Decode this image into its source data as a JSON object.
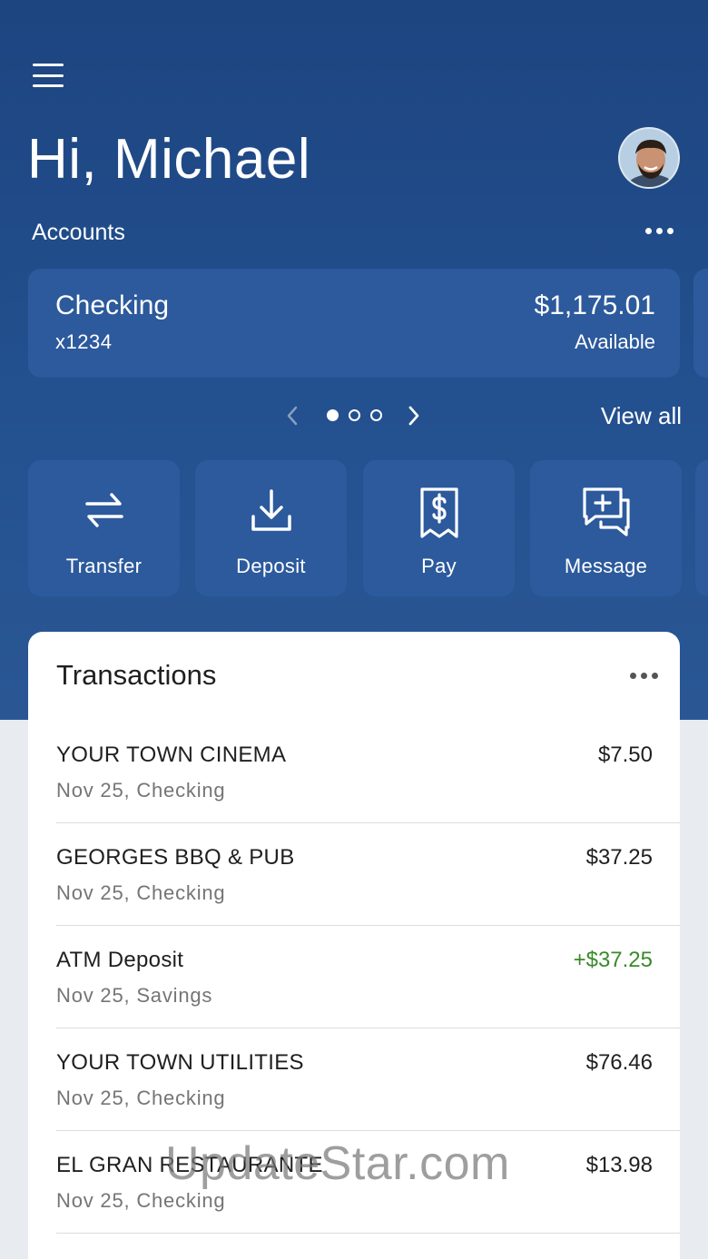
{
  "header": {
    "greeting": "Hi, Michael"
  },
  "accounts": {
    "label": "Accounts",
    "card": {
      "name": "Checking",
      "number": "x1234",
      "balance": "$1,175.01",
      "balance_label": "Available"
    },
    "pager": {
      "count": 3,
      "active_index": 0
    },
    "view_all": "View all"
  },
  "actions": [
    {
      "label": "Transfer",
      "icon": "transfer-icon"
    },
    {
      "label": "Deposit",
      "icon": "deposit-icon"
    },
    {
      "label": "Pay",
      "icon": "pay-bill-icon"
    },
    {
      "label": "Message",
      "icon": "message-icon"
    }
  ],
  "transactions": {
    "title": "Transactions",
    "items": [
      {
        "merchant": "YOUR TOWN CINEMA",
        "meta": "Nov 25, Checking",
        "amount": "$7.50",
        "credit": false
      },
      {
        "merchant": "GEORGES BBQ & PUB",
        "meta": "Nov 25, Checking",
        "amount": "$37.25",
        "credit": false
      },
      {
        "merchant": "ATM Deposit",
        "meta": "Nov 25, Savings",
        "amount": "+$37.25",
        "credit": true
      },
      {
        "merchant": "YOUR TOWN UTILITIES",
        "meta": "Nov 25, Checking",
        "amount": "$76.46",
        "credit": false
      },
      {
        "merchant": "EL GRAN RESTAURANTE",
        "meta": "Nov 25, Checking",
        "amount": "$13.98",
        "credit": false
      }
    ]
  },
  "colors": {
    "hero": "#1d4580",
    "card": "#2c5a9c",
    "credit": "#3a8a2a"
  },
  "watermark": "UpdateStar.com"
}
